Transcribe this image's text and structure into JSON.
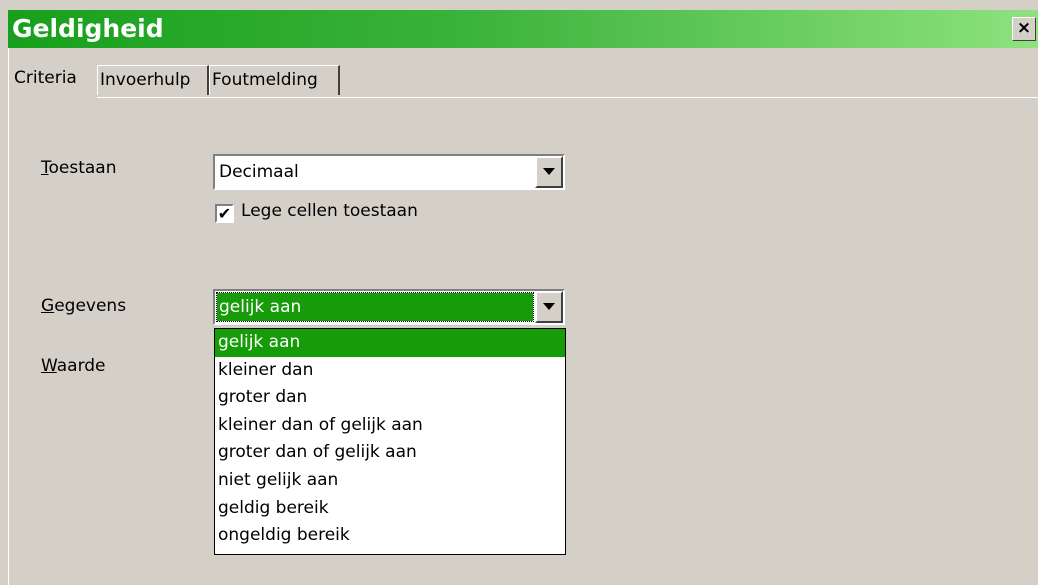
{
  "dialog": {
    "title": "Geldigheid",
    "close_glyph": "×"
  },
  "tabs": [
    {
      "label": "Criteria",
      "active": true
    },
    {
      "label": "Invoerhulp",
      "active": false
    },
    {
      "label": "Foutmelding",
      "active": false
    }
  ],
  "fields": {
    "toestaan": {
      "label_key": "T",
      "label_rest": "oestaan",
      "value": "Decimaal"
    },
    "lege_cellen": {
      "checked": true,
      "check_glyph": "✔",
      "label_key": "L",
      "label_rest": "ege cellen toestaan"
    },
    "gegevens": {
      "label_key": "G",
      "label_rest": "egevens",
      "value": "gelijk aan"
    },
    "waarde": {
      "label_key": "W",
      "label_rest": "aarde"
    }
  },
  "gegevens_options": [
    "gelijk aan",
    "kleiner dan",
    "groter dan",
    "kleiner dan of gelijk aan",
    "groter dan of gelijk aan",
    "niet gelijk aan",
    "geldig bereik",
    "ongeldig bereik"
  ],
  "gegevens_selected_index": 0,
  "colors": {
    "title_gradient_start": "#17a01c",
    "title_gradient_end": "#8ee27f",
    "selection": "#169c09",
    "dialog_bg": "#d4d0c8"
  }
}
